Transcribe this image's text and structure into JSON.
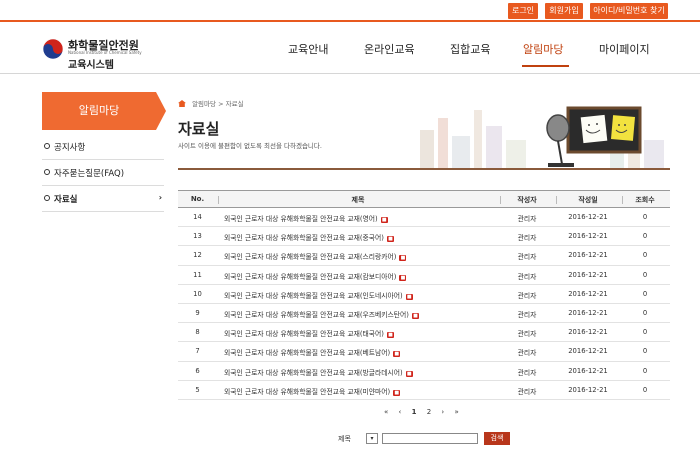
{
  "util_bar": {
    "login": "로그인",
    "join": "회원가입",
    "find": "아이디/비밀번호 찾기"
  },
  "logo": {
    "title": "화학물질안전원",
    "subtitle": "National Institute of Chemical Safety",
    "system": "교육시스템"
  },
  "gnb": [
    "교육안내",
    "온라인교육",
    "집합교육",
    "알림마당",
    "마이페이지"
  ],
  "gnb_active": "알림마당",
  "lnb": {
    "title": "알림마당",
    "items": [
      {
        "label": "공지사항"
      },
      {
        "label": "자주묻는질문(FAQ)"
      },
      {
        "label": "자료실",
        "arrow": "›"
      }
    ]
  },
  "breadcrumb": {
    "section": "알림마당",
    "sep": ">",
    "page": "자료실"
  },
  "page": {
    "title": "자료실",
    "description": "사이트 이용에 불편함이 없도록 최선을 다하겠습니다."
  },
  "table": {
    "headers": [
      "No.",
      "제목",
      "작성자",
      "작성일",
      "조회수"
    ],
    "rows": [
      {
        "no": "14",
        "title": "외국인 근로자 대상 유해화학물질 안전교육 교재(영어)",
        "author": "관리자",
        "date": "2016-12-21",
        "views": "0"
      },
      {
        "no": "13",
        "title": "외국인 근로자 대상 유해화학물질 안전교육 교재(중국어)",
        "author": "관리자",
        "date": "2016-12-21",
        "views": "0"
      },
      {
        "no": "12",
        "title": "외국인 근로자 대상 유해화학물질 안전교육 교재(스리랑카어)",
        "author": "관리자",
        "date": "2016-12-21",
        "views": "0"
      },
      {
        "no": "11",
        "title": "외국인 근로자 대상 유해화학물질 안전교육 교재(캄보디아어)",
        "author": "관리자",
        "date": "2016-12-21",
        "views": "0"
      },
      {
        "no": "10",
        "title": "외국인 근로자 대상 유해화학물질 안전교육 교재(인도네시아어)",
        "author": "관리자",
        "date": "2016-12-21",
        "views": "0"
      },
      {
        "no": "9",
        "title": "외국인 근로자 대상 유해화학물질 안전교육 교재(우즈베키스탄어)",
        "author": "관리자",
        "date": "2016-12-21",
        "views": "0"
      },
      {
        "no": "8",
        "title": "외국인 근로자 대상 유해화학물질 안전교육 교재(태국어)",
        "author": "관리자",
        "date": "2016-12-21",
        "views": "0"
      },
      {
        "no": "7",
        "title": "외국인 근로자 대상 유해화학물질 안전교육 교재(베트남어)",
        "author": "관리자",
        "date": "2016-12-21",
        "views": "0"
      },
      {
        "no": "6",
        "title": "외국인 근로자 대상 유해화학물질 안전교육 교재(방글라데시어)",
        "author": "관리자",
        "date": "2016-12-21",
        "views": "0"
      },
      {
        "no": "5",
        "title": "외국인 근로자 대상 유해화학물질 안전교육 교재(미얀마어)",
        "author": "관리자",
        "date": "2016-12-21",
        "views": "0"
      }
    ]
  },
  "pagination": {
    "first": "«",
    "prev": "‹",
    "pages": [
      "1",
      "2"
    ],
    "current": "1",
    "next": "›",
    "last": "»"
  },
  "search": {
    "field_label": "제목",
    "select_icon": "chevron-down-icon",
    "query": "",
    "button": "검색"
  },
  "colors": {
    "accent": "#e8591f",
    "active_menu": "#c0410f",
    "divider": "#8a5a3b",
    "new_badge": "#d0241b"
  }
}
